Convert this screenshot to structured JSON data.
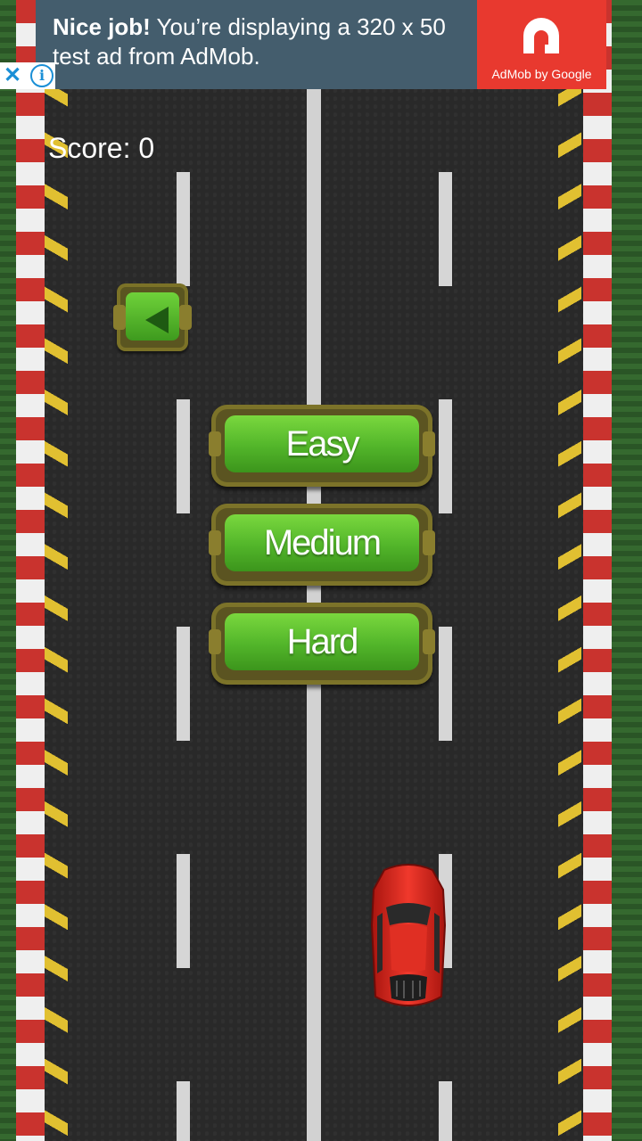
{
  "ad": {
    "headline_bold": "Nice job!",
    "headline_rest": " You’re displaying a 320 x 50 test ad from AdMob.",
    "brand": "AdMob by Google",
    "close_icon": "close-x-icon",
    "info_icon": "info-icon",
    "colors": {
      "banner": "#445d6d",
      "logo": "#e8392f",
      "icons": "#1a8fd6"
    }
  },
  "hud": {
    "score_label": "Score: 0"
  },
  "menu": {
    "back_icon": "left-arrow-icon",
    "buttons": [
      {
        "label": "Easy"
      },
      {
        "label": "Medium"
      },
      {
        "label": "Hard"
      }
    ],
    "colors": {
      "button_green": "#52b52a",
      "button_frame": "#5b5421"
    }
  },
  "scene": {
    "road_color": "#292929",
    "curb_colors": [
      "#c9332e",
      "#efefef"
    ],
    "hazard_color": "#e1c031",
    "player_car": "red-car"
  }
}
